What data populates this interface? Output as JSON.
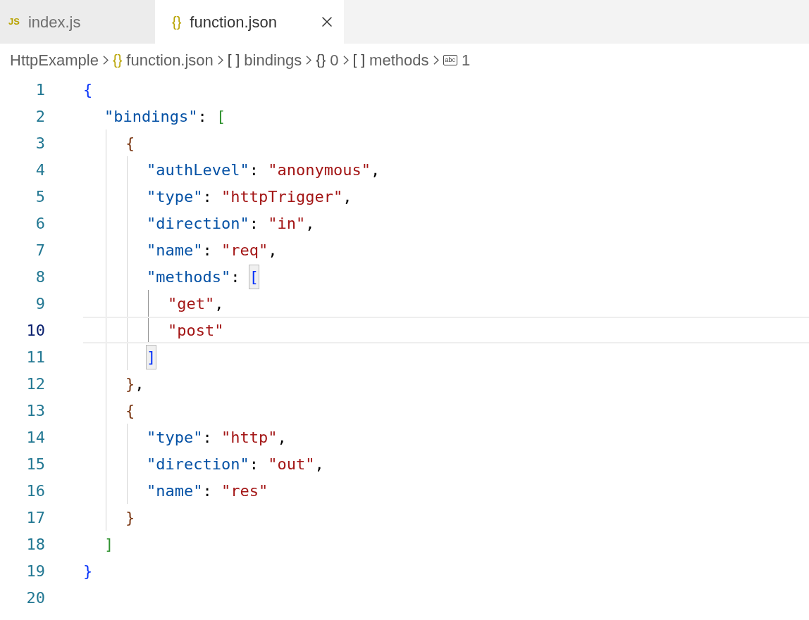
{
  "tabs": [
    {
      "kind": "js",
      "icon_text": "JS",
      "label": "index.js",
      "selected": false
    },
    {
      "kind": "json",
      "icon_text": "{}",
      "label": "function.json",
      "selected": true
    }
  ],
  "breadcrumb": [
    {
      "kind": "folder",
      "label": "HttpExample"
    },
    {
      "kind": "file",
      "icon_text": "{}",
      "label": "function.json"
    },
    {
      "kind": "array",
      "icon_text": "[ ]",
      "label": "bindings"
    },
    {
      "kind": "object",
      "icon_text": "{}",
      "label": "0"
    },
    {
      "kind": "array",
      "icon_text": "[ ]",
      "label": "methods"
    },
    {
      "kind": "string",
      "icon_text": "abc",
      "label": "1"
    }
  ],
  "lines": [
    {
      "number": "1",
      "current": false,
      "tokens": [
        {
          "kind": "bracket",
          "text": "{"
        }
      ]
    },
    {
      "number": "2",
      "current": false,
      "tokens": [
        {
          "kind": "key",
          "text": "\"bindings\""
        },
        {
          "kind": "punct",
          "text": ": "
        },
        {
          "kind": "bracket",
          "text": "["
        }
      ]
    },
    {
      "number": "3",
      "current": false,
      "tokens": [
        {
          "kind": "bracket",
          "text": "{"
        }
      ]
    },
    {
      "number": "4",
      "current": false,
      "tokens": [
        {
          "kind": "key",
          "text": "\"authLevel\""
        },
        {
          "kind": "punct",
          "text": ": "
        },
        {
          "kind": "string",
          "text": "\"anonymous\""
        },
        {
          "kind": "punct",
          "text": ","
        }
      ]
    },
    {
      "number": "5",
      "current": false,
      "tokens": [
        {
          "kind": "key",
          "text": "\"type\""
        },
        {
          "kind": "punct",
          "text": ": "
        },
        {
          "kind": "string",
          "text": "\"httpTrigger\""
        },
        {
          "kind": "punct",
          "text": ","
        }
      ]
    },
    {
      "number": "6",
      "current": false,
      "tokens": [
        {
          "kind": "key",
          "text": "\"direction\""
        },
        {
          "kind": "punct",
          "text": ": "
        },
        {
          "kind": "string",
          "text": "\"in\""
        },
        {
          "kind": "punct",
          "text": ","
        }
      ]
    },
    {
      "number": "7",
      "current": false,
      "tokens": [
        {
          "kind": "key",
          "text": "\"name\""
        },
        {
          "kind": "punct",
          "text": ": "
        },
        {
          "kind": "string",
          "text": "\"req\""
        },
        {
          "kind": "punct",
          "text": ","
        }
      ]
    },
    {
      "number": "8",
      "current": false,
      "tokens": [
        {
          "kind": "key",
          "text": "\"methods\""
        },
        {
          "kind": "punct",
          "text": ": "
        },
        {
          "kind": "bracket",
          "text": "[",
          "matched": true
        }
      ]
    },
    {
      "number": "9",
      "current": false,
      "tokens": [
        {
          "kind": "string",
          "text": "\"get\""
        },
        {
          "kind": "punct",
          "text": ","
        }
      ]
    },
    {
      "number": "10",
      "current": true,
      "tokens": [
        {
          "kind": "string",
          "text": "\"post\""
        }
      ]
    },
    {
      "number": "11",
      "current": false,
      "tokens": [
        {
          "kind": "bracket",
          "text": "]",
          "matched": true
        }
      ]
    },
    {
      "number": "12",
      "current": false,
      "tokens": [
        {
          "kind": "bracket",
          "text": "}"
        },
        {
          "kind": "punct",
          "text": ","
        }
      ]
    },
    {
      "number": "13",
      "current": false,
      "tokens": [
        {
          "kind": "bracket",
          "text": "{"
        }
      ]
    },
    {
      "number": "14",
      "current": false,
      "tokens": [
        {
          "kind": "key",
          "text": "\"type\""
        },
        {
          "kind": "punct",
          "text": ": "
        },
        {
          "kind": "string",
          "text": "\"http\""
        },
        {
          "kind": "punct",
          "text": ","
        }
      ]
    },
    {
      "number": "15",
      "current": false,
      "tokens": [
        {
          "kind": "key",
          "text": "\"direction\""
        },
        {
          "kind": "punct",
          "text": ": "
        },
        {
          "kind": "string",
          "text": "\"out\""
        },
        {
          "kind": "punct",
          "text": ","
        }
      ]
    },
    {
      "number": "16",
      "current": false,
      "tokens": [
        {
          "kind": "key",
          "text": "\"name\""
        },
        {
          "kind": "punct",
          "text": ": "
        },
        {
          "kind": "string",
          "text": "\"res\""
        }
      ]
    },
    {
      "number": "17",
      "current": false,
      "tokens": [
        {
          "kind": "bracket",
          "text": "}"
        }
      ]
    },
    {
      "number": "18",
      "current": false,
      "tokens": [
        {
          "kind": "bracket",
          "text": "]"
        }
      ]
    },
    {
      "number": "19",
      "current": false,
      "tokens": [
        {
          "kind": "bracket",
          "text": "}"
        }
      ]
    },
    {
      "number": "20",
      "current": false
    }
  ]
}
